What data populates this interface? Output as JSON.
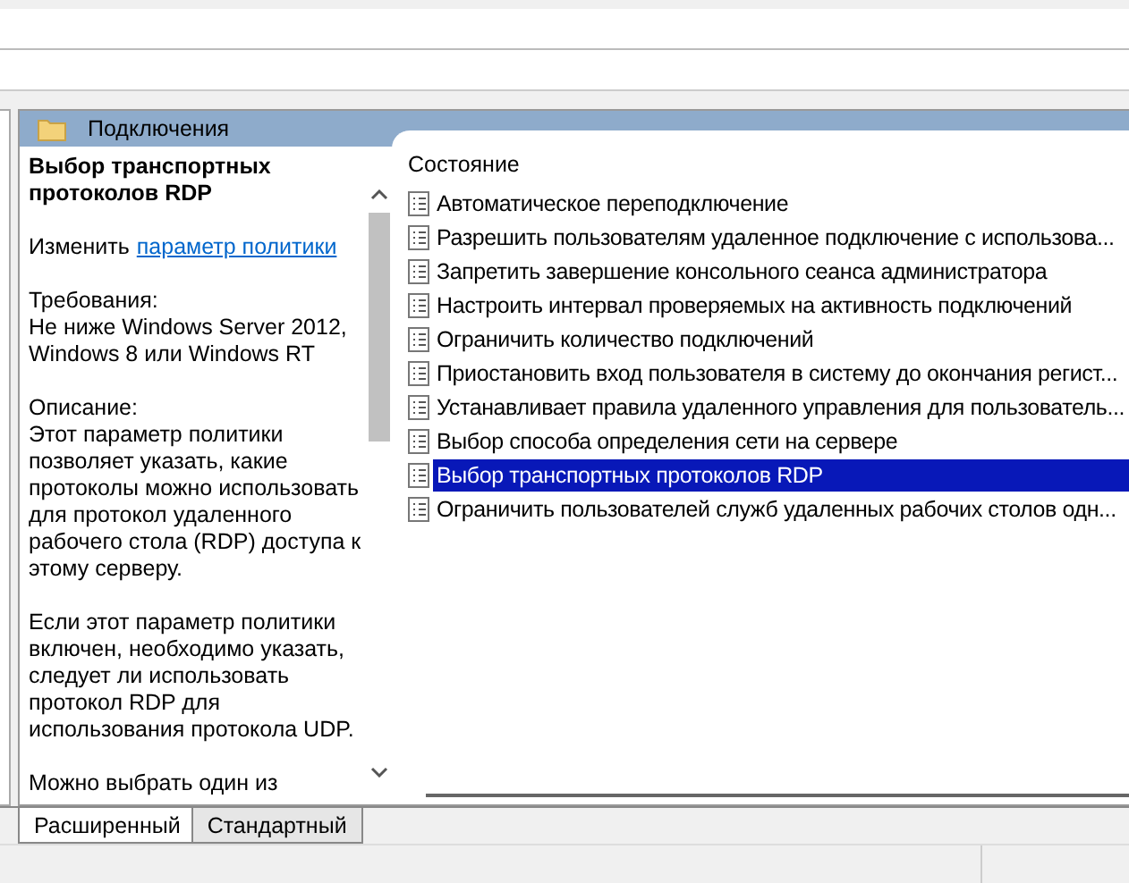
{
  "panel": {
    "title": "Подключения"
  },
  "description": {
    "title": "Выбор транспортных протоколов RDP",
    "edit_prefix": "Изменить",
    "edit_link": "параметр политики",
    "paragraphs": [
      "Требования:\nНе ниже Windows Server 2012, Windows 8 или Windows RT",
      "Описание:\nЭтот параметр политики позволяет указать, какие протоколы можно использовать для протокол удаленного рабочего стола (RDP) доступа к этому серверу.",
      "Если этот параметр политики включен, необходимо указать, следует ли использовать протокол RDP для использования протокола UDP.",
      "Можно выбрать один из"
    ]
  },
  "list": {
    "column": "Состояние",
    "items": [
      {
        "label": "Автоматическое переподключение",
        "selected": false
      },
      {
        "label": "Разрешить пользователям удаленное подключение с использова...",
        "selected": false
      },
      {
        "label": "Запретить завершение консольного сеанса администратора",
        "selected": false
      },
      {
        "label": "Настроить интервал проверяемых на активность подключений",
        "selected": false
      },
      {
        "label": "Ограничить количество подключений",
        "selected": false
      },
      {
        "label": "Приостановить вход пользователя в систему до окончания регист...",
        "selected": false
      },
      {
        "label": "Устанавливает правила удаленного управления для пользователь...",
        "selected": false
      },
      {
        "label": "Выбор способа определения сети на сервере",
        "selected": false
      },
      {
        "label": "Выбор транспортных протоколов RDP",
        "selected": true
      },
      {
        "label": "Ограничить пользователей служб удаленных рабочих столов одн...",
        "selected": false
      }
    ]
  },
  "tabs": [
    {
      "label": "Расширенный",
      "selected": true
    },
    {
      "label": "Стандартный",
      "selected": false
    }
  ]
}
